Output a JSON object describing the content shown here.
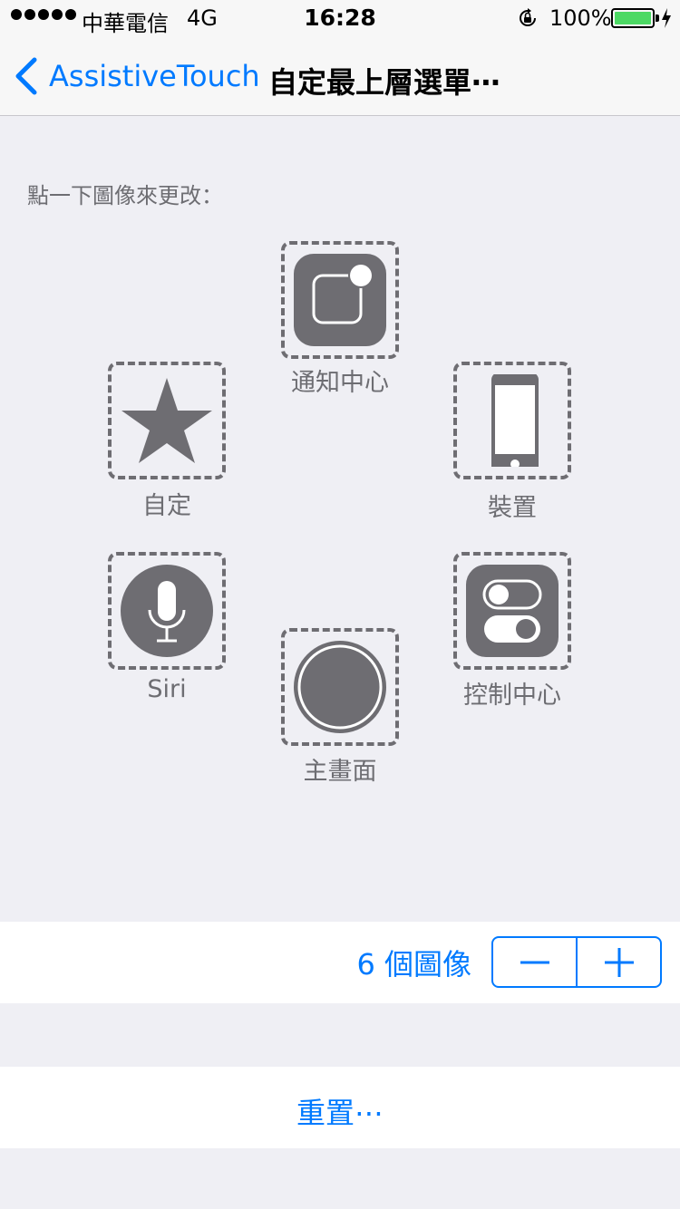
{
  "status_bar": {
    "carrier": "中華電信",
    "network": "4G",
    "time": "16:28",
    "battery_percent": "100%",
    "battery_level": 1.0,
    "battery_color": "#4cd964"
  },
  "nav": {
    "back_label": "AssistiveTouch",
    "title": "自定最上層選單⋯"
  },
  "instruction": "點一下圖像來更改：",
  "icons": {
    "notification_center": {
      "label": "通知中心",
      "icon": "notification-center-icon"
    },
    "custom": {
      "label": "自定",
      "icon": "star-icon"
    },
    "device": {
      "label": "裝置",
      "icon": "iphone-icon"
    },
    "siri": {
      "label": "Siri",
      "icon": "microphone-icon"
    },
    "control_center": {
      "label": "控制中心",
      "icon": "toggle-switches-icon"
    },
    "home": {
      "label": "主畫面",
      "icon": "home-button-icon"
    }
  },
  "count_row": {
    "label": "6 個圖像",
    "decrement_icon": "minus-icon",
    "increment_icon": "plus-icon"
  },
  "reset_label": "重置⋯",
  "colors": {
    "accent": "#007aff",
    "icon_gray": "#6e6d72",
    "background": "#efeff4"
  }
}
